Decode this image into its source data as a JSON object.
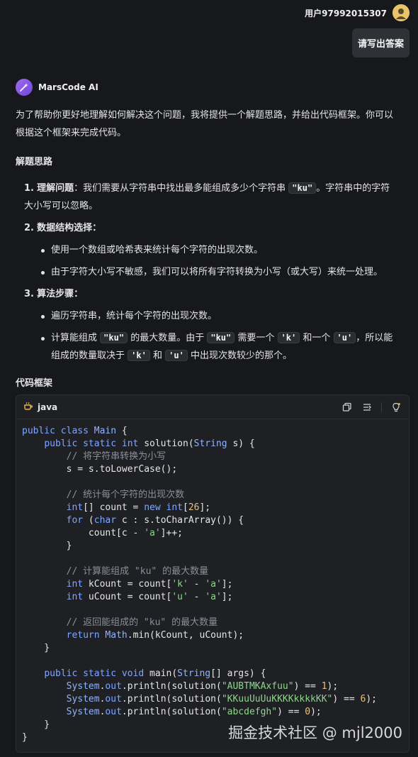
{
  "user": {
    "name": "用户97992015307",
    "message": "请写出答案"
  },
  "assistant": {
    "name": "MarsCode AI"
  },
  "intro": "为了帮助你更好地理解如何解决这个问题，我将提供一个解题思路，并给出代码框架。你可以根据这个框架来完成代码。",
  "thinking_title": "解题思路",
  "steps": [
    {
      "num": "1.",
      "head": "理解问题",
      "text_a": "：我们需要从字符串中找出最多能组成多少个字符串",
      "code": "\"ku\"",
      "text_b": "。字符串中的字符大小写可以忽略。"
    },
    {
      "num": "2.",
      "head": "数据结构选择",
      "text_a": "：",
      "bullets": [
        "使用一个数组或哈希表来统计每个字符的出现次数。",
        "由于字符大小写不敏感，我们可以将所有字符转换为小写（或大写）来统一处理。"
      ]
    },
    {
      "num": "3.",
      "head": "算法步骤",
      "text_a": "：",
      "bullet1": "遍历字符串，统计每个字符的出现次数。",
      "bullet2": {
        "p1": "计算能组成",
        "c1": "\"ku\"",
        "p2": "的最大数量。由于",
        "c2": "\"ku\"",
        "p3": "需要一个",
        "c3": "'k'",
        "p4": "和一个",
        "c4": "'u'",
        "p5": "，所以能组成的数量取决于",
        "c5": "'k'",
        "p6": "和",
        "c6": "'u'",
        "p7": "中出现次数较少的那个。"
      }
    }
  ],
  "code_title": "代码框架",
  "code_block": {
    "language": "java",
    "icons": [
      "copy-icon",
      "insert-icon",
      "lightbulb-icon"
    ]
  },
  "watermark": "掘金技术社区 @ mjl2000",
  "colors": {
    "background": "#17181b",
    "code_bg": "#1f2024",
    "keyword": "#7fa7ff",
    "string": "#8fd48f",
    "comment": "#8a8f98",
    "number": "#e8c07d"
  }
}
